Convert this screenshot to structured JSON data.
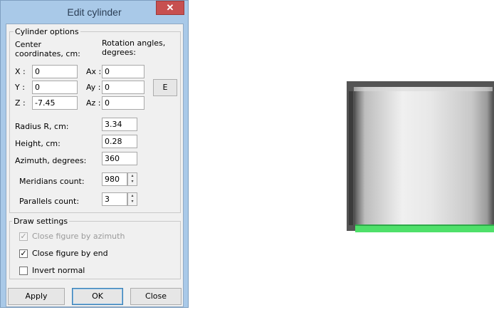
{
  "dialog": {
    "title": "Edit cylinder",
    "close_glyph": "✕",
    "cylinder_options": {
      "legend": "Cylinder options",
      "center_label": "Center coordinates, cm:",
      "rotation_label": "Rotation angles, degrees:",
      "x_label": "X :",
      "x_value": "0",
      "y_label": "Y :",
      "y_value": "0",
      "z_label": "Z :",
      "z_value": "-7.45",
      "ax_label": "Ax :",
      "ax_value": "0",
      "ay_label": "Ay :",
      "ay_value": "0",
      "az_label": "Az :",
      "az_value": "0",
      "e_button": "E",
      "radius_label": "Radius R, cm:",
      "radius_value": "3.34",
      "height_label": "Height, cm:",
      "height_value": "0.28",
      "azimuth_label": "Azimuth, degrees:",
      "azimuth_value": "360",
      "meridians_label": "Meridians count:",
      "meridians_value": "980",
      "parallels_label": "Parallels count:",
      "parallels_value": "3"
    },
    "draw_settings": {
      "legend": "Draw settings",
      "close_by_azimuth": {
        "label": "Close figure by azimuth",
        "checked": true,
        "enabled": false
      },
      "close_by_end": {
        "label": "Close figure by end",
        "checked": true,
        "enabled": true
      },
      "invert_normal": {
        "label": "Invert normal",
        "checked": false,
        "enabled": true
      }
    },
    "buttons": {
      "apply": "Apply",
      "ok": "OK",
      "close": "Close"
    }
  },
  "viewport": {
    "colors": {
      "body_dark": "#5e5e5e",
      "body_light": "#e6e6e6",
      "end_cap": "#4fe06a"
    }
  }
}
